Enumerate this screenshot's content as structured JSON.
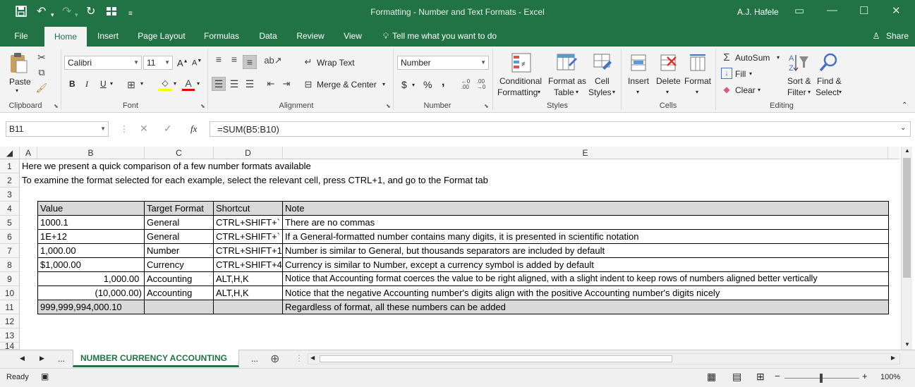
{
  "window": {
    "title": "Formatting - Number and Text Formats  -  Excel",
    "user": "A.J. Hafele"
  },
  "menu": {
    "tabs": [
      "File",
      "Home",
      "Insert",
      "Page Layout",
      "Formulas",
      "Data",
      "Review",
      "View"
    ],
    "tell_me": "Tell me what you want to do",
    "share": "Share"
  },
  "ribbon": {
    "clipboard": {
      "label": "Clipboard",
      "paste": "Paste"
    },
    "font": {
      "label": "Font",
      "family": "Calibri",
      "size": "11",
      "bold": "B",
      "italic": "I",
      "underline": "U"
    },
    "alignment": {
      "label": "Alignment",
      "wrap": "Wrap Text",
      "merge": "Merge & Center"
    },
    "number": {
      "label": "Number",
      "format": "Number",
      "currency": "$",
      "percent": "%",
      "comma": ","
    },
    "styles": {
      "label": "Styles",
      "conditional_1": "Conditional",
      "conditional_2": "Formatting",
      "table_1": "Format as",
      "table_2": "Table",
      "cell_1": "Cell",
      "cell_2": "Styles"
    },
    "cells": {
      "label": "Cells",
      "insert": "Insert",
      "delete": "Delete",
      "format": "Format"
    },
    "editing": {
      "label": "Editing",
      "autosum": "AutoSum",
      "fill": "Fill",
      "clear": "Clear",
      "sort_1": "Sort &",
      "sort_2": "Filter",
      "find_1": "Find &",
      "find_2": "Select"
    }
  },
  "formula_bar": {
    "name_box": "B11",
    "fx": "fx",
    "formula": "=SUM(B5:B10)"
  },
  "columns": [
    "A",
    "B",
    "C",
    "D",
    "E"
  ],
  "rows": [
    "1",
    "2",
    "3",
    "4",
    "5",
    "6",
    "7",
    "8",
    "9",
    "10",
    "11",
    "12",
    "13",
    "14"
  ],
  "intro": {
    "line1": "Here we present a quick comparison of a few number formats available",
    "line2": "To examine the format selected for each example, select the relevant cell, press CTRL+1, and go to the Format tab"
  },
  "table": {
    "headers": [
      "Value",
      "Target Format",
      "Shortcut",
      "Note"
    ],
    "rows": [
      [
        "1000.1",
        "General",
        "CTRL+SHIFT+`",
        "There are no commas"
      ],
      [
        "1E+12",
        "General",
        "CTRL+SHIFT+`",
        "If a General-formatted number contains many digits, it is presented in scientific notation"
      ],
      [
        "1,000.00",
        "Number",
        "CTRL+SHIFT+1",
        "Number is similar to General, but thousands separators are included by default"
      ],
      [
        "$1,000.00",
        "Currency",
        "CTRL+SHIFT+4",
        "Currency is similar to Number, except a currency symbol is added by default"
      ],
      [
        "1,000.00 ",
        "Accounting",
        "ALT,H,K",
        "Notice that Accounting format coerces the value to be right aligned, with a slight indent to  keep rows of numbers aligned better vertically"
      ],
      [
        "(10,000.00)",
        "Accounting",
        "ALT,H,K",
        "Notice that the negative Accounting number's digits align with the positive Accounting number's digits nicely"
      ],
      [
        "999,999,994,000.10",
        "",
        "",
        "Regardless of format, all these numbers can be added"
      ]
    ]
  },
  "sheet": {
    "active_tab": "NUMBER CURRENCY ACCOUNTING",
    "ellipsis": "..."
  },
  "status": {
    "ready": "Ready",
    "zoom": "100%"
  },
  "colors": {
    "excel_green": "#217346",
    "header_gray": "#d9d9d9"
  }
}
